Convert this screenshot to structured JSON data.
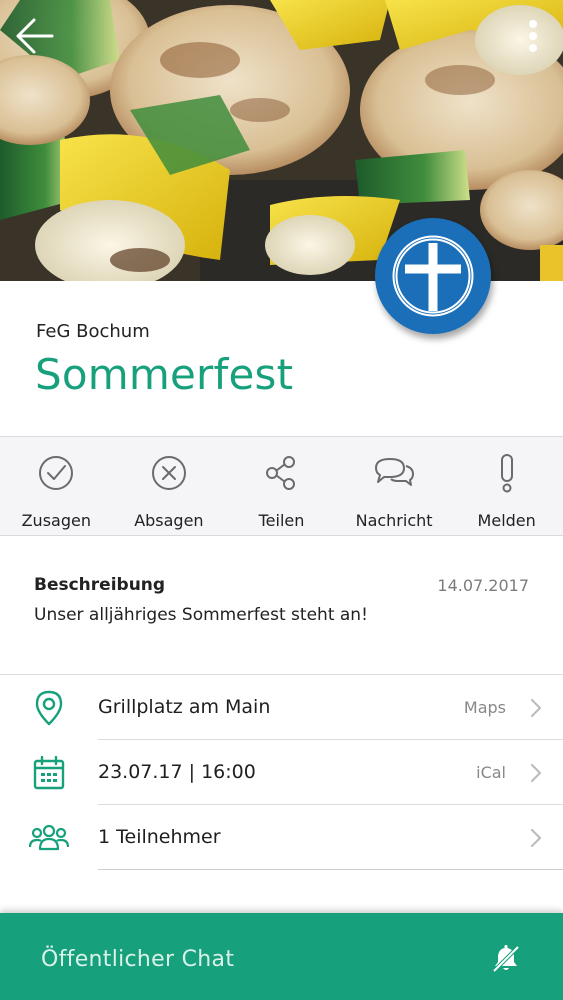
{
  "header": {
    "org": "FeG Bochum",
    "title": "Sommerfest"
  },
  "icons": {
    "back": "arrow-left-icon",
    "more": "more-vertical-icon",
    "logo": "church-cross-logo"
  },
  "actions": [
    {
      "label": "Zusagen",
      "icon": "check-circle-icon"
    },
    {
      "label": "Absagen",
      "icon": "x-circle-icon"
    },
    {
      "label": "Teilen",
      "icon": "share-icon"
    },
    {
      "label": "Nachricht",
      "icon": "chat-bubbles-icon"
    },
    {
      "label": "Melden",
      "icon": "exclamation-icon"
    }
  ],
  "description": {
    "heading": "Beschreibung",
    "date": "14.07.2017",
    "text": "Unser alljähriges Sommerfest steht an!"
  },
  "rows": [
    {
      "text": "Grillplatz am Main",
      "action": "Maps",
      "icon": "location-pin-icon"
    },
    {
      "text": "23.07.17 | 16:00",
      "action": "iCal",
      "icon": "calendar-icon"
    },
    {
      "text": "1 Teilnehmer",
      "action": "",
      "icon": "people-icon"
    }
  ],
  "chat": {
    "label": "Öffentlicher Chat",
    "icon": "bell-muted-icon"
  },
  "colors": {
    "accent": "#17a07c",
    "logo_blue": "#1b6fb8",
    "action_bar": "#f5f4f7"
  }
}
